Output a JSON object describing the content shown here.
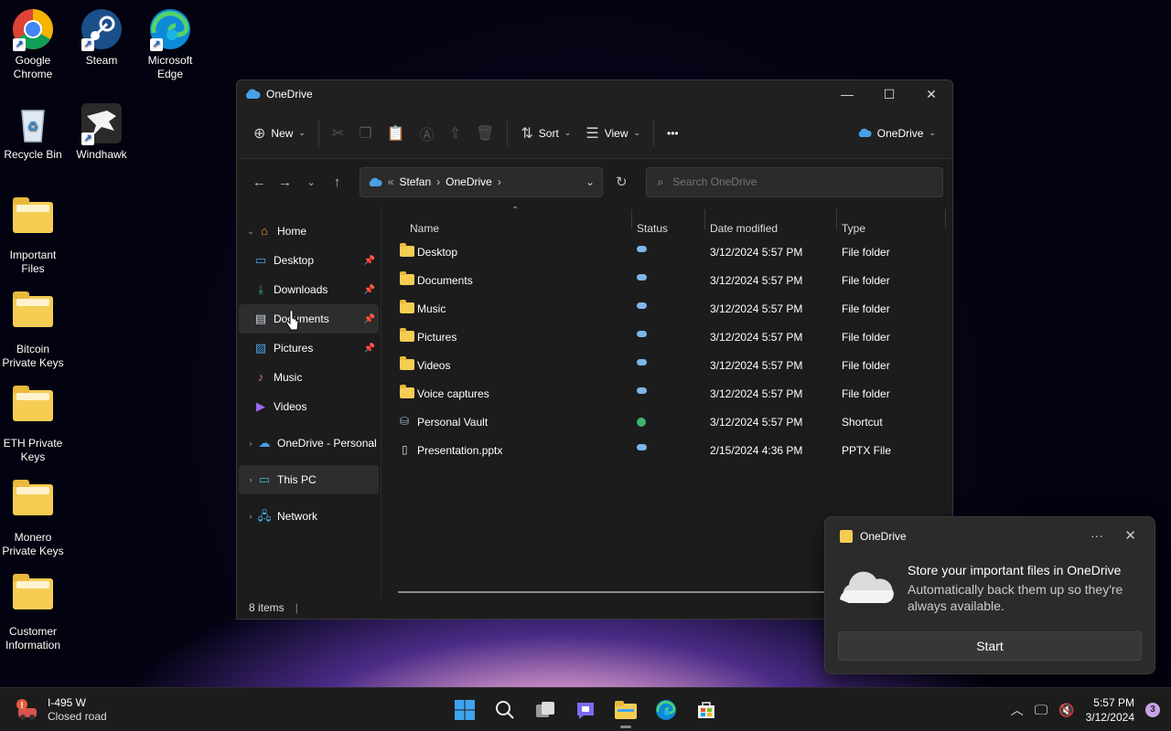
{
  "desktop": {
    "icons": [
      {
        "label": "Google Chrome"
      },
      {
        "label": "Steam"
      },
      {
        "label": "Microsoft Edge"
      },
      {
        "label": "Recycle Bin"
      },
      {
        "label": "Windhawk"
      },
      {
        "label": "Important Files"
      },
      {
        "label": "Bitcoin Private Keys"
      },
      {
        "label": "ETH Private Keys"
      },
      {
        "label": "Monero Private Keys"
      },
      {
        "label": "Customer Information"
      }
    ]
  },
  "window": {
    "title": "OneDrive",
    "toolbar": {
      "new_label": "New",
      "sort_label": "Sort",
      "view_label": "View",
      "more_label": "•••",
      "account_label": "OneDrive"
    },
    "address": {
      "sep": "«",
      "crumb1": "Stefan",
      "crumb2": "OneDrive"
    },
    "search_placeholder": "Search OneDrive",
    "sidebar": {
      "items": [
        {
          "label": "Home"
        },
        {
          "label": "Desktop"
        },
        {
          "label": "Downloads"
        },
        {
          "label": "Documents"
        },
        {
          "label": "Pictures"
        },
        {
          "label": "Music"
        },
        {
          "label": "Videos"
        },
        {
          "label": "OneDrive - Personal"
        },
        {
          "label": "This PC"
        },
        {
          "label": "Network"
        }
      ]
    },
    "columns": {
      "name": "Name",
      "status": "Status",
      "date": "Date modified",
      "type": "Type"
    },
    "files": [
      {
        "name": "Desktop",
        "status": "cloud",
        "date": "3/12/2024 5:57 PM",
        "type": "File folder"
      },
      {
        "name": "Documents",
        "status": "cloud",
        "date": "3/12/2024 5:57 PM",
        "type": "File folder"
      },
      {
        "name": "Music",
        "status": "cloud",
        "date": "3/12/2024 5:57 PM",
        "type": "File folder"
      },
      {
        "name": "Pictures",
        "status": "cloud",
        "date": "3/12/2024 5:57 PM",
        "type": "File folder"
      },
      {
        "name": "Videos",
        "status": "cloud",
        "date": "3/12/2024 5:57 PM",
        "type": "File folder"
      },
      {
        "name": "Voice captures",
        "status": "cloud",
        "date": "3/12/2024 5:57 PM",
        "type": "File folder"
      },
      {
        "name": "Personal Vault",
        "status": "synced",
        "date": "3/12/2024 5:57 PM",
        "type": "Shortcut"
      },
      {
        "name": "Presentation.pptx",
        "status": "cloud",
        "date": "2/15/2024 4:36 PM",
        "type": "PPTX File"
      }
    ],
    "status_text": "8 items"
  },
  "toast": {
    "app": "OneDrive",
    "more": "···",
    "heading": "Store your important files in OneDrive",
    "body": "Automatically back them up so they're always available.",
    "button": "Start"
  },
  "taskbar": {
    "weather_title": "I-495 W",
    "weather_sub": "Closed road",
    "time": "5:57 PM",
    "date": "3/12/2024",
    "notifications": "3"
  },
  "colors": {
    "accent": "#4aa0e6",
    "folder": "#f5cd53",
    "cloud": "#7cb6ea",
    "synced": "#3cb371"
  }
}
